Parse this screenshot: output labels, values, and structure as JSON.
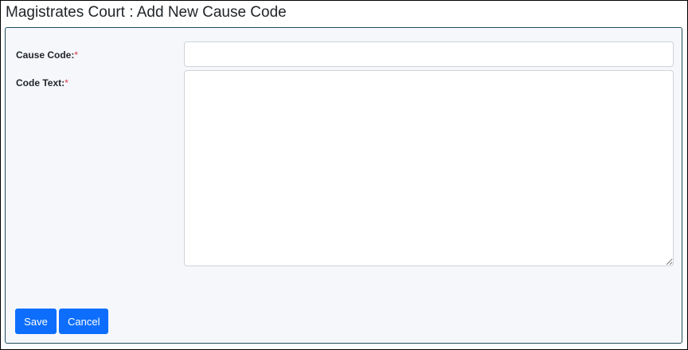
{
  "page": {
    "title": "Magistrates Court : Add New Cause Code"
  },
  "form": {
    "cause_code": {
      "label": "Cause Code:",
      "required_mark": "*",
      "value": "",
      "placeholder": ""
    },
    "code_text": {
      "label": "Code Text:",
      "required_mark": "*",
      "value": "",
      "placeholder": ""
    }
  },
  "actions": {
    "save_label": "Save",
    "cancel_label": "Cancel"
  },
  "colors": {
    "button_primary": "#0d6efd",
    "required_asterisk": "#dc3545",
    "panel_background": "#f5f7fb",
    "panel_border": "#1f4e5f"
  }
}
